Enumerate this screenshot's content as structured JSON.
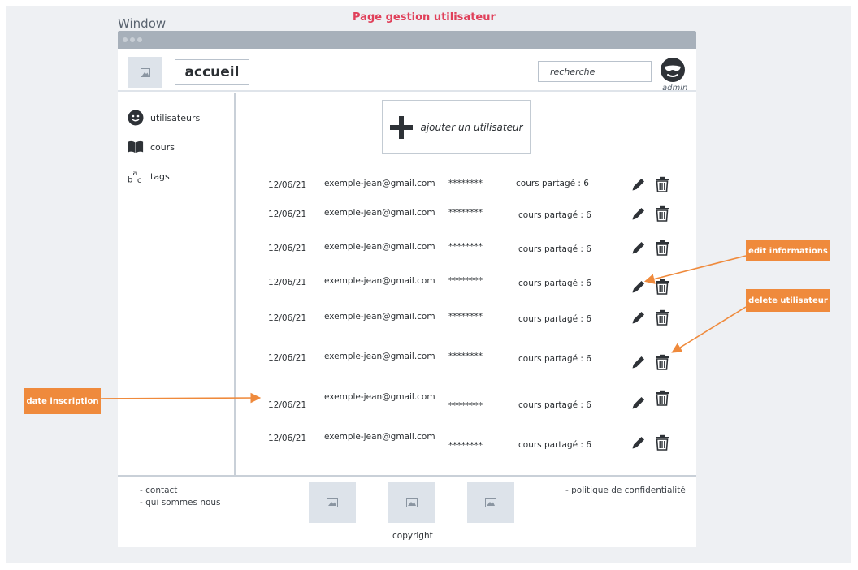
{
  "window_label": "Window",
  "page_title": "Page gestion utilisateur",
  "header": {
    "home_label": "accueil",
    "search_placeholder": "recherche",
    "admin_label": "admin"
  },
  "sidebar": {
    "items": [
      {
        "label": "utilisateurs",
        "icon": "smiley-icon"
      },
      {
        "label": "cours",
        "icon": "book-icon"
      },
      {
        "label": "tags",
        "icon": "abc-icon"
      }
    ]
  },
  "main": {
    "add_user_label": "ajouter un utilisateur",
    "rows": [
      {
        "date": "12/06/21",
        "email": "exemple-jean@gmail.com",
        "password": "********",
        "cours": "cours partagé : 6"
      },
      {
        "date": "12/06/21",
        "email": "exemple-jean@gmail.com",
        "password": "********",
        "cours": "cours partagé : 6"
      },
      {
        "date": "12/06/21",
        "email": "exemple-jean@gmail.com",
        "password": "********",
        "cours": "cours partagé : 6"
      },
      {
        "date": "12/06/21",
        "email": "exemple-jean@gmail.com",
        "password": "********",
        "cours": "cours partagé : 6"
      },
      {
        "date": "12/06/21",
        "email": "exemple-jean@gmail.com",
        "password": "********",
        "cours": "cours partagé : 6"
      },
      {
        "date": "12/06/21",
        "email": "exemple-jean@gmail.com",
        "password": "********",
        "cours": "cours partagé : 6"
      },
      {
        "date": "12/06/21",
        "email": "exemple-jean@gmail.com",
        "password": "********",
        "cours": "cours partagé : 6"
      },
      {
        "date": "12/06/21",
        "email": "exemple-jean@gmail.com",
        "password": "********",
        "cours": "cours partagé : 6"
      }
    ]
  },
  "footer": {
    "contact": "- contact",
    "about": "- qui sommes nous",
    "privacy": "- politique de confidentialité",
    "copyright": "copyright"
  },
  "annotations": {
    "edit": "edit informations",
    "delete": "delete utilisateur",
    "date": "date inscription"
  },
  "colors": {
    "annotation": "#ef8a3c",
    "title": "#e0405a",
    "titlebar": "#a7b0ba"
  }
}
